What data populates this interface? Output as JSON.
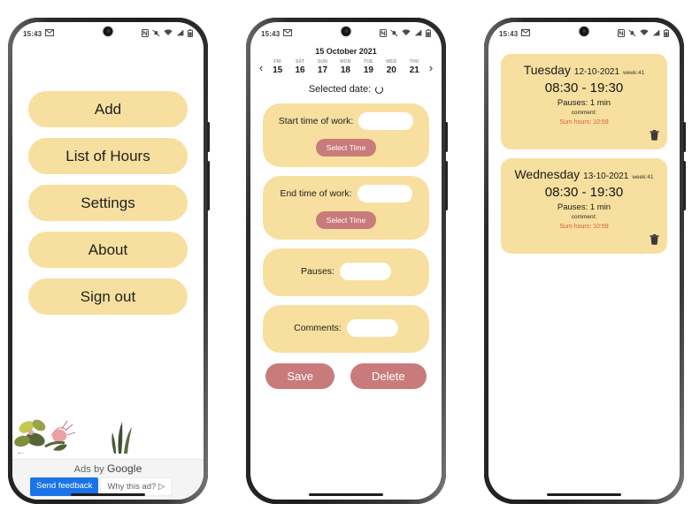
{
  "status_bar": {
    "time": "15:43",
    "icons_left": [
      "gmail-icon"
    ],
    "icons_right": [
      "nfc-icon",
      "notifications-muted-icon",
      "wifi-icon",
      "signal-icon",
      "battery-icon"
    ]
  },
  "phone1": {
    "menu_buttons": [
      {
        "label": "Add"
      },
      {
        "label": "List of Hours"
      },
      {
        "label": "Settings"
      },
      {
        "label": "About"
      },
      {
        "label": "Sign out"
      }
    ],
    "ad": {
      "attribution": "Ads by ",
      "brand": "Google",
      "send_feedback": "Send feedback",
      "why_this_ad": "Why this ad? ▷",
      "back_arrow": "←"
    }
  },
  "phone2": {
    "date_title": "15 October 2021",
    "prev_arrow": "‹",
    "next_arrow": "›",
    "days": [
      {
        "dow": "FRI",
        "num": "15"
      },
      {
        "dow": "SAT",
        "num": "16"
      },
      {
        "dow": "SUN",
        "num": "17"
      },
      {
        "dow": "MON",
        "num": "18"
      },
      {
        "dow": "TUE",
        "num": "19"
      },
      {
        "dow": "WED",
        "num": "20"
      },
      {
        "dow": "THU",
        "num": "21"
      }
    ],
    "selected_date_label": "Selected date:",
    "fields": [
      {
        "label": "Start time of work:",
        "value": "",
        "button": "Select Time"
      },
      {
        "label": "End time of work:",
        "value": "",
        "button": "Select Time"
      },
      {
        "label": "Pauses:",
        "value": ""
      },
      {
        "label": "Comments:",
        "value": ""
      }
    ],
    "save_label": "Save",
    "delete_label": "Delete"
  },
  "phone3": {
    "entries": [
      {
        "day": "Tuesday",
        "date": "12-10-2021",
        "week": "week:41",
        "time_range": "08:30 - 19:30",
        "pauses": "Pauses:  1 min",
        "comment": "comment:",
        "sum": "Sum hours: 10:59"
      },
      {
        "day": "Wednesday",
        "date": "13-10-2021",
        "week": "week:41",
        "time_range": "08:30 - 19:30",
        "pauses": "Pauses:  1 min",
        "comment": "comment:",
        "sum": "Sum hours: 10:59"
      }
    ]
  },
  "colors": {
    "card_yellow": "#f7df9f",
    "accent_red": "#c97b7b",
    "sum_red": "#d4603f",
    "ad_blue": "#1a73e8"
  }
}
